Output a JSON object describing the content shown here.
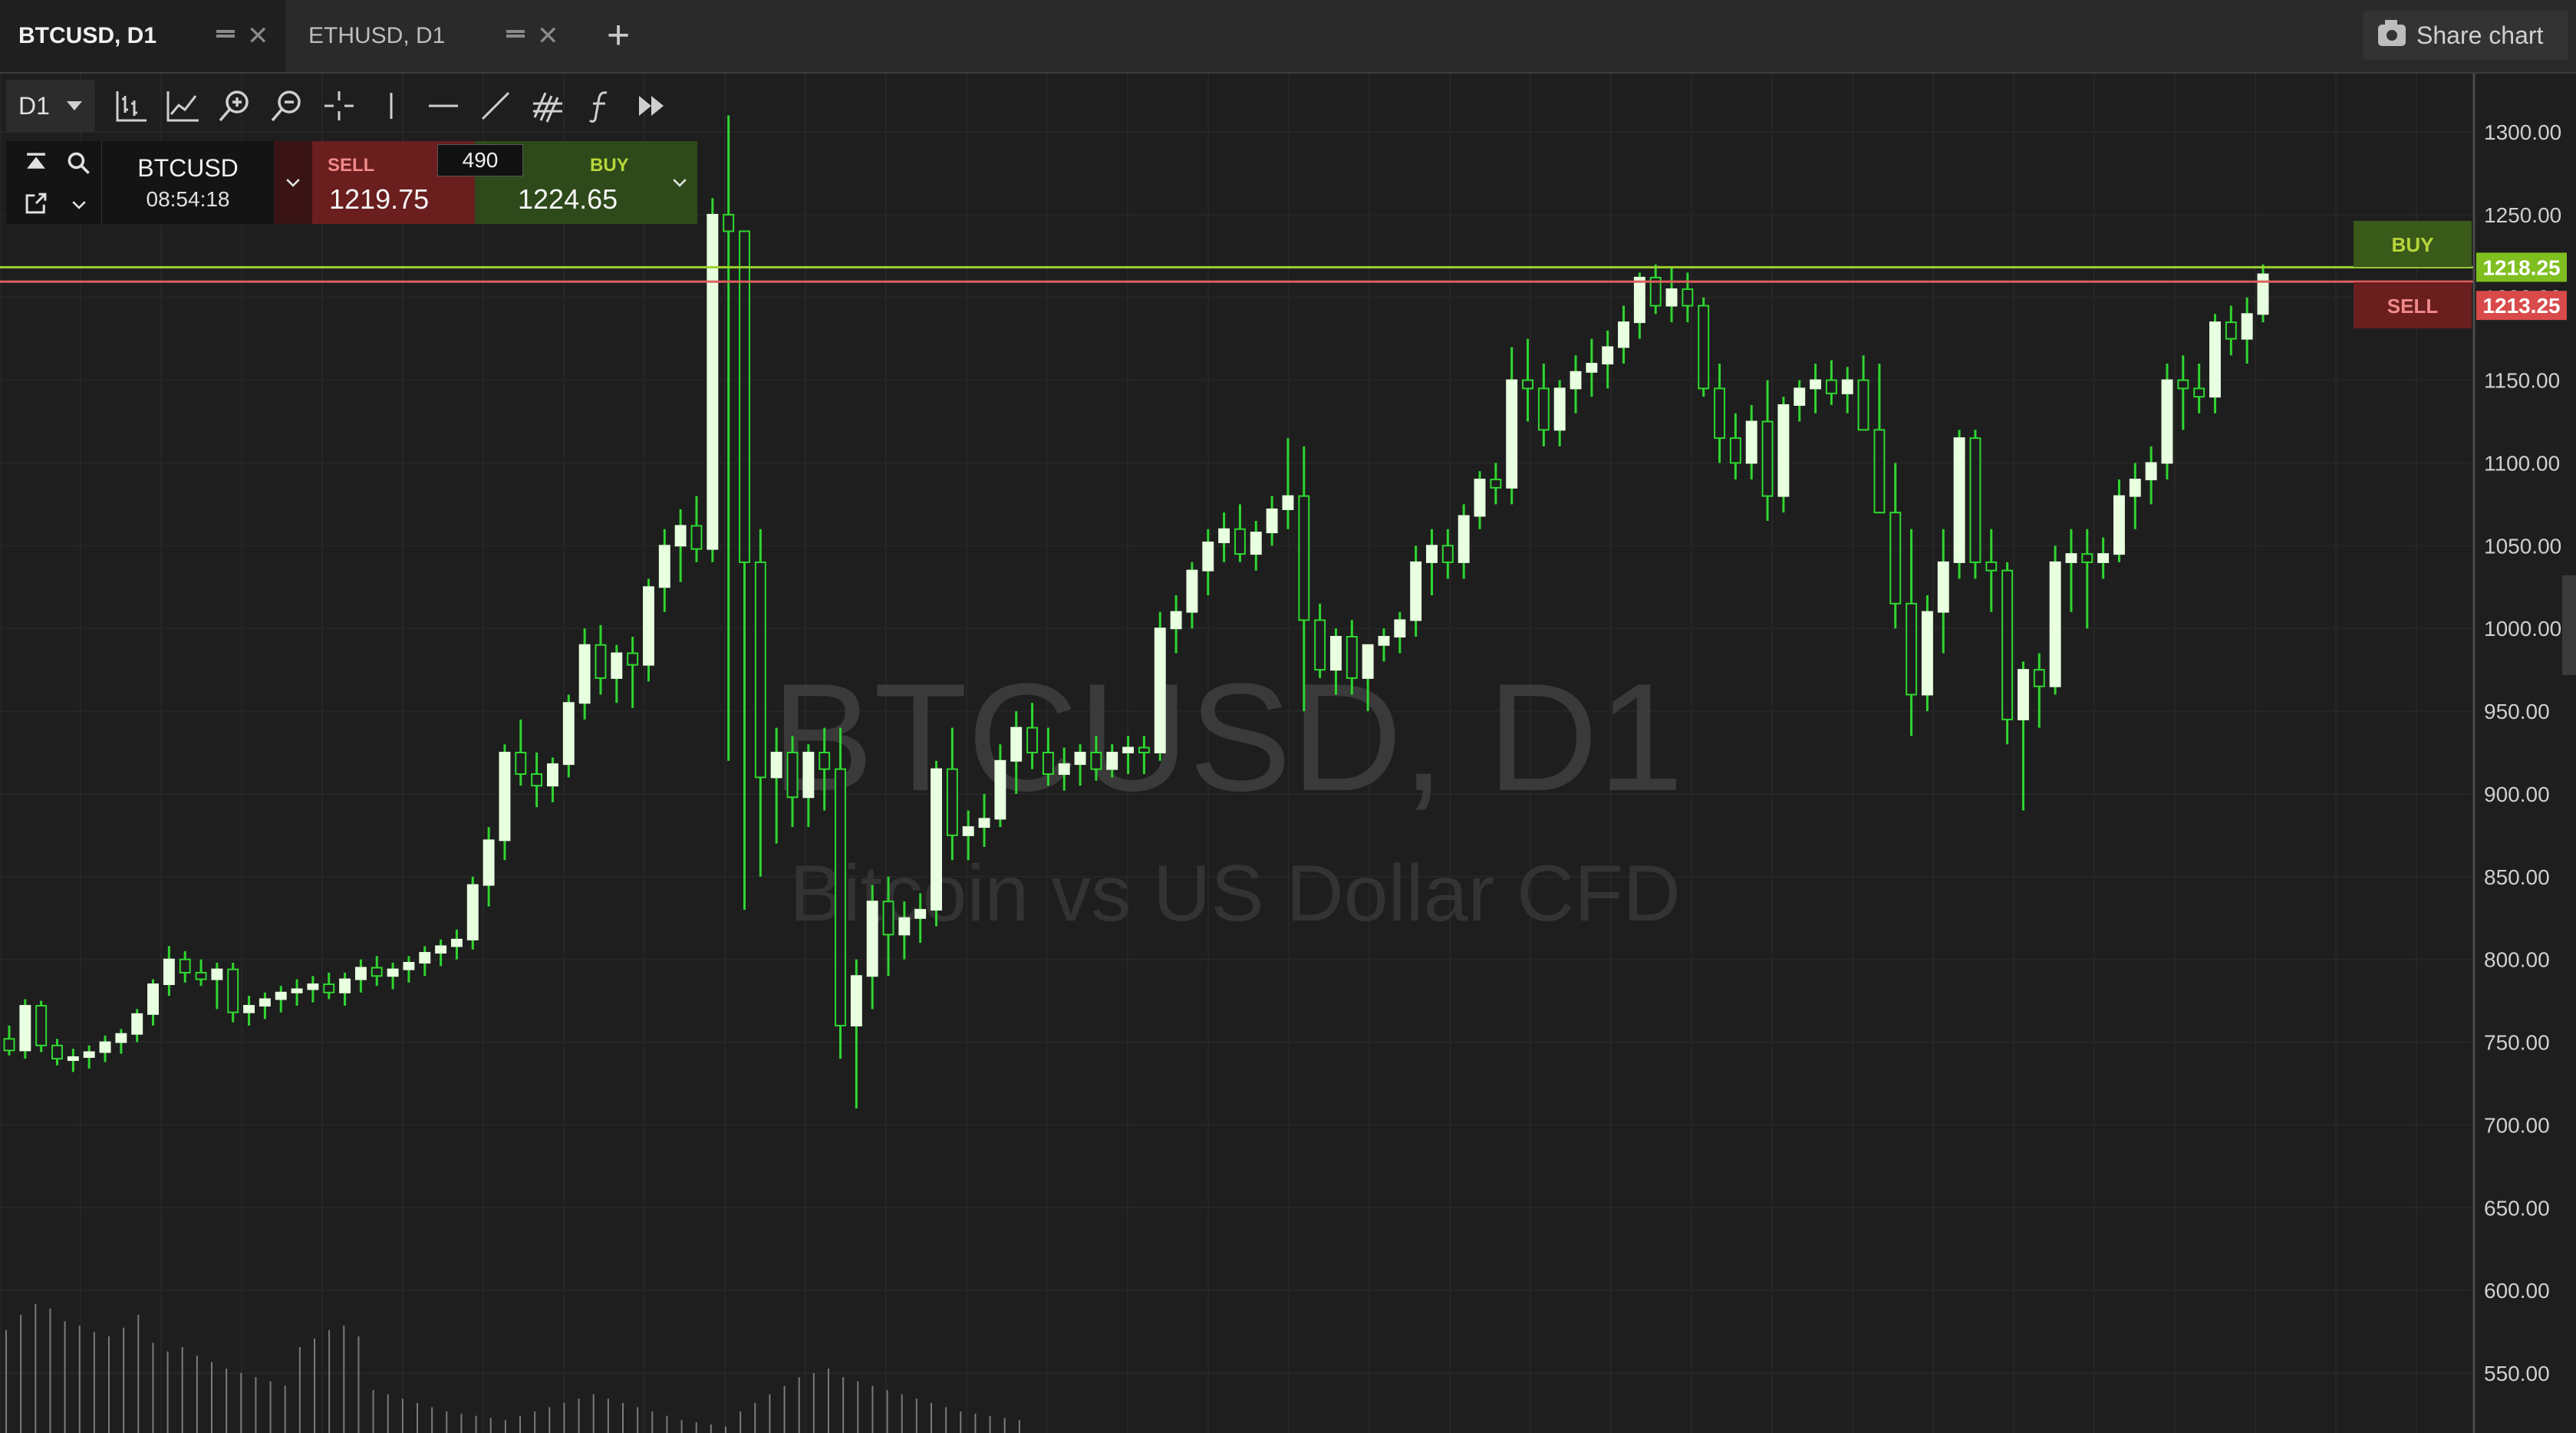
{
  "tabs": [
    {
      "label": "BTCUSD, D1",
      "active": true
    },
    {
      "label": "ETHUSD, D1",
      "active": false
    }
  ],
  "share_label": "Share chart",
  "toolbar": {
    "timeframe": "D1",
    "tools": [
      "chart-type-icon",
      "indicators-icon",
      "zoom-in-icon",
      "zoom-out-icon",
      "crosshair-icon",
      "vertical-line-icon",
      "horizontal-line-icon",
      "trend-line-icon",
      "fibonacci-icon",
      "function-icon",
      "fast-forward-icon"
    ]
  },
  "trade_panel": {
    "symbol": "BTCUSD",
    "clock": "08:54:18",
    "sell_label": "SELL",
    "sell_price": "1219.75",
    "spread": "490",
    "buy_label": "BUY",
    "buy_price": "1224.65"
  },
  "watermark": {
    "title": "BTCUSD, D1",
    "subtitle": "Bitcoin vs US Dollar CFD"
  },
  "price_axis": {
    "ticks": [
      "1300.00",
      "1250.00",
      "1200.00",
      "1150.00",
      "1100.00",
      "1050.00",
      "1000.00",
      "950.00",
      "900.00",
      "850.00",
      "800.00",
      "750.00",
      "700.00",
      "650.00",
      "600.00",
      "550.00"
    ],
    "buy_tag": "1218.25",
    "sell_tag": "1213.25"
  },
  "side_buttons": {
    "buy": "BUY",
    "sell": "SELL"
  },
  "colors": {
    "background": "#1e1e1e",
    "bull": "#e8ffe0",
    "wick": "#2fd62f",
    "buy_line": "#9bd12f",
    "sell_line": "#e06060",
    "buy_tag": "#7fbf1f",
    "sell_tag": "#d94a4a"
  },
  "chart_data": {
    "type": "candlestick",
    "symbol": "BTCUSD",
    "timeframe": "D1",
    "ylim": [
      540,
      1320
    ],
    "buy_price": 1218.25,
    "sell_price": 1213.25,
    "candles": [
      [
        752,
        760,
        742,
        745
      ],
      [
        745,
        776,
        740,
        772
      ],
      [
        772,
        775,
        744,
        748
      ],
      [
        748,
        752,
        736,
        740
      ],
      [
        740,
        746,
        732,
        741
      ],
      [
        741,
        748,
        734,
        744
      ],
      [
        744,
        754,
        738,
        750
      ],
      [
        750,
        758,
        743,
        755
      ],
      [
        755,
        770,
        750,
        767
      ],
      [
        767,
        788,
        760,
        785
      ],
      [
        785,
        808,
        778,
        800
      ],
      [
        800,
        805,
        786,
        792
      ],
      [
        792,
        800,
        784,
        788
      ],
      [
        788,
        798,
        770,
        794
      ],
      [
        794,
        798,
        762,
        768
      ],
      [
        768,
        778,
        760,
        772
      ],
      [
        772,
        780,
        764,
        776
      ],
      [
        776,
        784,
        768,
        780
      ],
      [
        780,
        788,
        772,
        782
      ],
      [
        782,
        790,
        774,
        785
      ],
      [
        785,
        792,
        776,
        780
      ],
      [
        780,
        792,
        772,
        788
      ],
      [
        788,
        800,
        780,
        795
      ],
      [
        795,
        802,
        784,
        790
      ],
      [
        790,
        798,
        782,
        794
      ],
      [
        794,
        802,
        786,
        798
      ],
      [
        798,
        808,
        790,
        804
      ],
      [
        804,
        812,
        796,
        808
      ],
      [
        808,
        818,
        800,
        812
      ],
      [
        812,
        850,
        806,
        845
      ],
      [
        845,
        880,
        832,
        872
      ],
      [
        872,
        930,
        860,
        925
      ],
      [
        925,
        945,
        905,
        912
      ],
      [
        912,
        925,
        892,
        905
      ],
      [
        905,
        922,
        895,
        918
      ],
      [
        918,
        960,
        910,
        955
      ],
      [
        955,
        1000,
        945,
        990
      ],
      [
        990,
        1002,
        960,
        970
      ],
      [
        970,
        990,
        955,
        985
      ],
      [
        985,
        995,
        952,
        978
      ],
      [
        978,
        1030,
        968,
        1025
      ],
      [
        1025,
        1060,
        1010,
        1050
      ],
      [
        1050,
        1072,
        1028,
        1062
      ],
      [
        1062,
        1080,
        1040,
        1048
      ],
      [
        1048,
        1260,
        1040,
        1250
      ],
      [
        1250,
        1310,
        920,
        1240
      ],
      [
        1240,
        1080,
        830,
        1040
      ],
      [
        1040,
        1060,
        850,
        910
      ],
      [
        910,
        940,
        870,
        925
      ],
      [
        925,
        935,
        880,
        898
      ],
      [
        898,
        930,
        880,
        925
      ],
      [
        925,
        940,
        890,
        915
      ],
      [
        915,
        940,
        740,
        760
      ],
      [
        760,
        800,
        710,
        790
      ],
      [
        790,
        845,
        770,
        835
      ],
      [
        835,
        850,
        790,
        815
      ],
      [
        815,
        835,
        800,
        825
      ],
      [
        825,
        840,
        810,
        830
      ],
      [
        830,
        920,
        820,
        915
      ],
      [
        915,
        940,
        860,
        875
      ],
      [
        875,
        890,
        860,
        880
      ],
      [
        880,
        900,
        868,
        885
      ],
      [
        885,
        930,
        880,
        920
      ],
      [
        920,
        950,
        900,
        940
      ],
      [
        940,
        955,
        915,
        925
      ],
      [
        925,
        940,
        905,
        912
      ],
      [
        912,
        928,
        902,
        918
      ],
      [
        918,
        930,
        905,
        925
      ],
      [
        925,
        935,
        908,
        915
      ],
      [
        915,
        930,
        910,
        925
      ],
      [
        925,
        935,
        912,
        928
      ],
      [
        928,
        935,
        912,
        925
      ],
      [
        925,
        1010,
        920,
        1000
      ],
      [
        1000,
        1020,
        985,
        1010
      ],
      [
        1010,
        1040,
        1000,
        1035
      ],
      [
        1035,
        1060,
        1020,
        1052
      ],
      [
        1052,
        1070,
        1040,
        1060
      ],
      [
        1060,
        1075,
        1040,
        1045
      ],
      [
        1045,
        1065,
        1035,
        1058
      ],
      [
        1058,
        1080,
        1050,
        1072
      ],
      [
        1072,
        1115,
        1060,
        1080
      ],
      [
        1080,
        1110,
        950,
        1005
      ],
      [
        1005,
        1015,
        970,
        975
      ],
      [
        975,
        1000,
        960,
        995
      ],
      [
        995,
        1005,
        960,
        970
      ],
      [
        970,
        985,
        950,
        990
      ],
      [
        990,
        1000,
        980,
        995
      ],
      [
        995,
        1010,
        985,
        1005
      ],
      [
        1005,
        1050,
        995,
        1040
      ],
      [
        1040,
        1060,
        1020,
        1050
      ],
      [
        1050,
        1060,
        1030,
        1040
      ],
      [
        1040,
        1075,
        1030,
        1068
      ],
      [
        1068,
        1095,
        1060,
        1090
      ],
      [
        1090,
        1100,
        1075,
        1085
      ],
      [
        1085,
        1170,
        1075,
        1150
      ],
      [
        1150,
        1175,
        1125,
        1145
      ],
      [
        1145,
        1160,
        1110,
        1120
      ],
      [
        1120,
        1150,
        1110,
        1145
      ],
      [
        1145,
        1165,
        1130,
        1155
      ],
      [
        1155,
        1175,
        1140,
        1160
      ],
      [
        1160,
        1180,
        1145,
        1170
      ],
      [
        1170,
        1195,
        1160,
        1185
      ],
      [
        1185,
        1215,
        1175,
        1212
      ],
      [
        1212,
        1220,
        1190,
        1195
      ],
      [
        1195,
        1218,
        1185,
        1205
      ],
      [
        1205,
        1215,
        1185,
        1195
      ],
      [
        1195,
        1200,
        1140,
        1145
      ],
      [
        1145,
        1160,
        1100,
        1115
      ],
      [
        1115,
        1130,
        1090,
        1100
      ],
      [
        1100,
        1135,
        1090,
        1125
      ],
      [
        1125,
        1150,
        1065,
        1080
      ],
      [
        1080,
        1140,
        1070,
        1135
      ],
      [
        1135,
        1150,
        1125,
        1145
      ],
      [
        1145,
        1160,
        1130,
        1150
      ],
      [
        1150,
        1162,
        1135,
        1142
      ],
      [
        1142,
        1158,
        1130,
        1150
      ],
      [
        1150,
        1165,
        1140,
        1120
      ],
      [
        1120,
        1160,
        1090,
        1070
      ],
      [
        1070,
        1100,
        1000,
        1015
      ],
      [
        1015,
        1060,
        935,
        960
      ],
      [
        960,
        1020,
        950,
        1010
      ],
      [
        1010,
        1060,
        985,
        1040
      ],
      [
        1040,
        1120,
        1030,
        1115
      ],
      [
        1115,
        1120,
        1030,
        1040
      ],
      [
        1040,
        1060,
        1010,
        1035
      ],
      [
        1035,
        1040,
        930,
        945
      ],
      [
        945,
        980,
        890,
        975
      ],
      [
        975,
        985,
        940,
        965
      ],
      [
        965,
        1050,
        960,
        1040
      ],
      [
        1040,
        1060,
        1010,
        1045
      ],
      [
        1045,
        1060,
        1000,
        1040
      ],
      [
        1040,
        1055,
        1030,
        1045
      ],
      [
        1045,
        1090,
        1040,
        1080
      ],
      [
        1080,
        1100,
        1060,
        1090
      ],
      [
        1090,
        1110,
        1075,
        1100
      ],
      [
        1100,
        1160,
        1090,
        1150
      ],
      [
        1150,
        1165,
        1120,
        1145
      ],
      [
        1145,
        1160,
        1130,
        1140
      ],
      [
        1140,
        1190,
        1130,
        1185
      ],
      [
        1185,
        1195,
        1165,
        1175
      ],
      [
        1175,
        1200,
        1160,
        1190
      ],
      [
        1190,
        1220,
        1185,
        1214
      ]
    ],
    "volume": [
      48,
      55,
      60,
      58,
      52,
      50,
      47,
      45,
      49,
      55,
      42,
      38,
      40,
      36,
      33,
      30,
      28,
      26,
      24,
      22,
      40,
      44,
      48,
      50,
      45,
      20,
      18,
      16,
      14,
      12,
      10,
      9,
      8,
      7,
      6,
      8,
      10,
      12,
      14,
      16,
      18,
      16,
      14,
      12,
      10,
      8,
      6,
      5,
      4,
      3,
      10,
      14,
      18,
      22,
      26,
      28,
      30,
      26,
      24,
      22,
      20,
      18,
      16,
      14,
      12,
      10,
      9,
      8,
      7,
      6
    ]
  }
}
